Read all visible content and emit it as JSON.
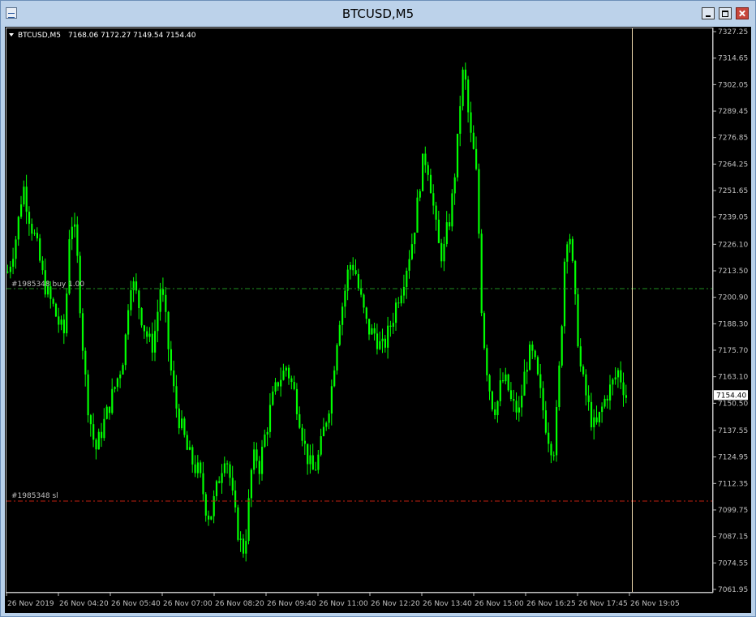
{
  "window": {
    "title": "BTCUSD,M5"
  },
  "info": {
    "symbol": "BTCUSD,M5",
    "ohlc": "7168.06 7172.27 7149.54 7154.40"
  },
  "orders": {
    "buy_label": "#1985348 buy 1.00",
    "sl_label": "#1985348 sl"
  },
  "colors": {
    "background": "#000000",
    "candle": "#00ff00",
    "axis": "#c0c0c0",
    "buy_line": "#1f8f1f",
    "sl_line": "#c02010",
    "cursor_line": "#f5deb3"
  },
  "chart_data": {
    "type": "candlestick",
    "symbol": "BTCUSD",
    "timeframe": "M5",
    "ohlc_current": {
      "open": 7168.06,
      "high": 7172.27,
      "low": 7149.54,
      "close": 7154.4
    },
    "current_price_label": "7154.40",
    "buy_level": 7205.0,
    "sl_level": 7104.0,
    "ylim": [
      7060.0,
      7328.0
    ],
    "y_ticks": [
      "7327.25",
      "7314.65",
      "7302.05",
      "7289.45",
      "7276.85",
      "7264.25",
      "7251.65",
      "7239.05",
      "7226.10",
      "7213.50",
      "7200.90",
      "7188.30",
      "7175.70",
      "7163.10",
      "7150.50",
      "7137.55",
      "7124.95",
      "7112.35",
      "7099.75",
      "7087.15",
      "7074.55",
      "7061.95"
    ],
    "x_ticks": [
      "26 Nov 2019",
      "26 Nov 04:20",
      "26 Nov 05:40",
      "26 Nov 07:00",
      "26 Nov 08:20",
      "26 Nov 09:40",
      "26 Nov 11:00",
      "26 Nov 12:20",
      "26 Nov 13:40",
      "26 Nov 15:00",
      "26 Nov 16:25",
      "26 Nov 17:45",
      "26 Nov 19:05"
    ],
    "close_path": [
      7213,
      7220,
      7228,
      7240,
      7255,
      7245,
      7236,
      7230,
      7222,
      7212,
      7205,
      7200,
      7196,
      7190,
      7186,
      7183,
      7230,
      7238,
      7225,
      7196,
      7168,
      7150,
      7138,
      7128,
      7134,
      7140,
      7146,
      7152,
      7158,
      7164,
      7170,
      7184,
      7210,
      7206,
      7200,
      7192,
      7185,
      7180,
      7178,
      7190,
      7206,
      7196,
      7178,
      7162,
      7150,
      7142,
      7136,
      7128,
      7124,
      7120,
      7118,
      7110,
      7100,
      7096,
      7104,
      7112,
      7120,
      7128,
      7118,
      7104,
      7092,
      7084,
      7080,
      7100,
      7122,
      7126,
      7120,
      7132,
      7140,
      7150,
      7156,
      7162,
      7164,
      7168,
      7162,
      7156,
      7148,
      7138,
      7128,
      7122,
      7118,
      7122,
      7130,
      7140,
      7148,
      7160,
      7178,
      7192,
      7200,
      7212,
      7218,
      7214,
      7204,
      7196,
      7188,
      7184,
      7184,
      7180,
      7176,
      7180,
      7186,
      7192,
      7200,
      7205,
      7212,
      7220,
      7228,
      7240,
      7256,
      7268,
      7264,
      7252,
      7236,
      7224,
      7220,
      7232,
      7240,
      7258,
      7278,
      7308,
      7302,
      7280,
      7270,
      7255,
      7200,
      7175,
      7160,
      7150,
      7148,
      7158,
      7162,
      7158,
      7150,
      7148,
      7146,
      7160,
      7170,
      7175,
      7170,
      7160,
      7150,
      7140,
      7132,
      7128,
      7150,
      7184,
      7224,
      7236,
      7214,
      7190,
      7168,
      7158,
      7150,
      7142,
      7138,
      7144,
      7150,
      7155,
      7158,
      7162,
      7166,
      7160,
      7154
    ],
    "volatility": 6
  }
}
